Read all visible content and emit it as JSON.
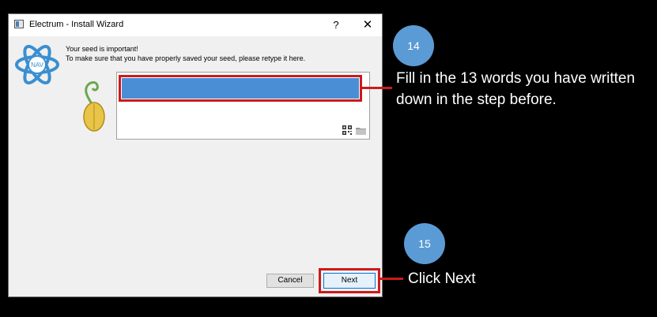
{
  "window": {
    "title": "Electrum  -  Install Wizard",
    "help_label": "?",
    "close_label": "✕",
    "logo_text": "NAV"
  },
  "messages": {
    "line1": "Your seed is important!",
    "line2": "To make sure that you have properly saved your seed, please retype it here."
  },
  "seed_field": {
    "value": "",
    "icons": [
      "qr-code-icon",
      "folder-icon"
    ]
  },
  "buttons": {
    "cancel": "Cancel",
    "next": "Next"
  },
  "callouts": [
    {
      "number": "14",
      "text_line1": "Fill in the 13 words you have written",
      "text_line2": "down in the step before."
    },
    {
      "number": "15",
      "text": "Click Next"
    }
  ],
  "colors": {
    "highlight": "#cc1a1a",
    "callout_circle": "#5b9bd5",
    "seed_selection": "#4a8ed6",
    "background": "#000000"
  }
}
